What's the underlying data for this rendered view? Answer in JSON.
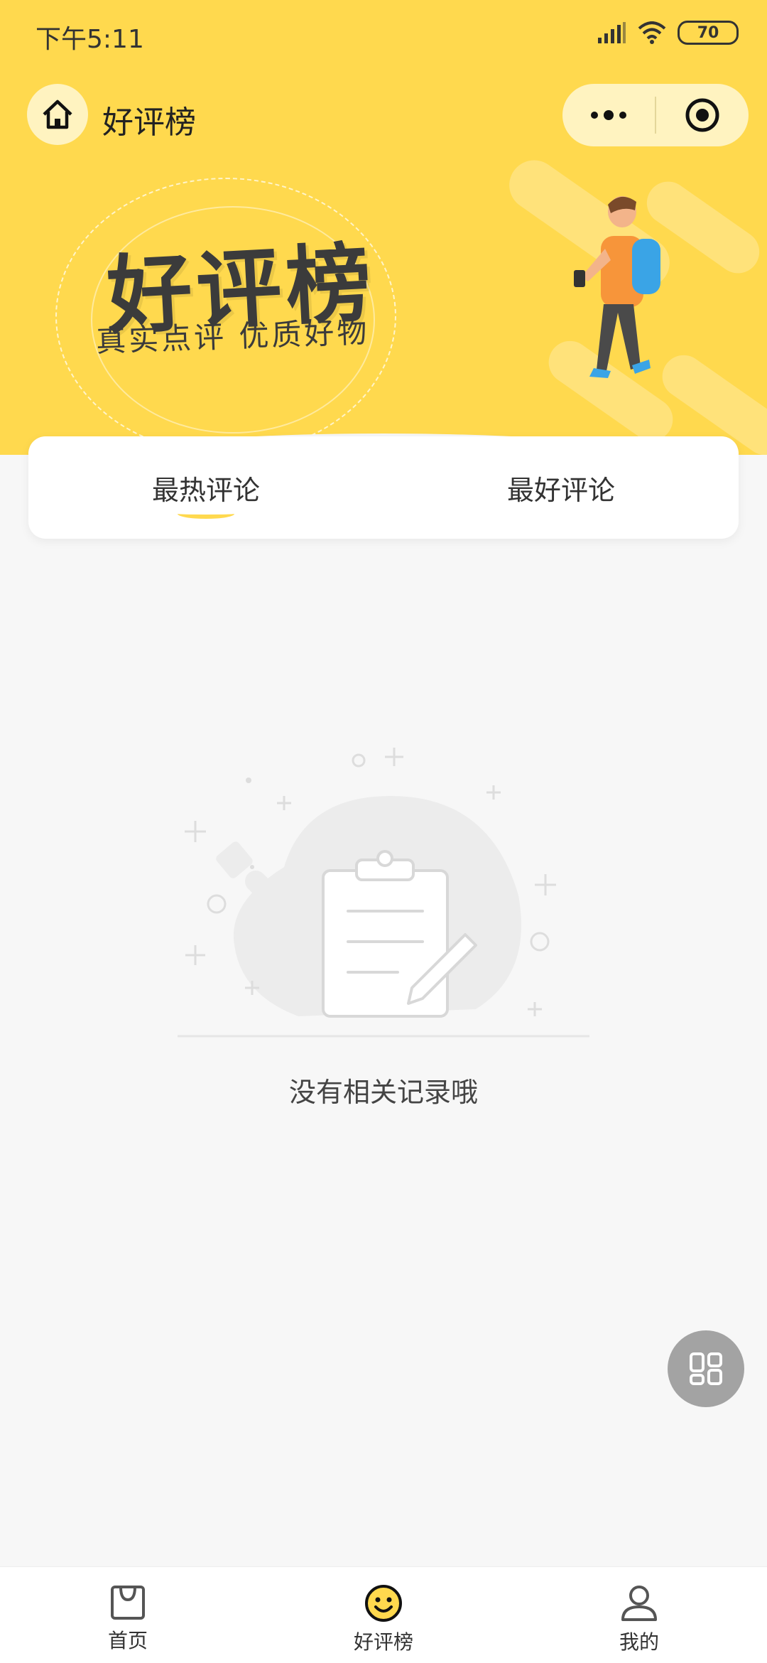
{
  "status_bar": {
    "time": "下午5:11",
    "battery": "70"
  },
  "nav": {
    "title": "好评榜"
  },
  "banner": {
    "title": "好评榜",
    "subtitle": "真实点评  优质好物"
  },
  "tabs": [
    {
      "label": "最热评论",
      "active": true
    },
    {
      "label": "最好评论",
      "active": false
    }
  ],
  "empty_state": {
    "text": "没有相关记录哦"
  },
  "tabbar": [
    {
      "label": "首页",
      "icon": "bag-icon"
    },
    {
      "label": "好评榜",
      "icon": "smiley-icon"
    },
    {
      "label": "我的",
      "icon": "user-icon"
    }
  ],
  "colors": {
    "accent": "#ffd94e",
    "background": "#f7f7f7"
  }
}
